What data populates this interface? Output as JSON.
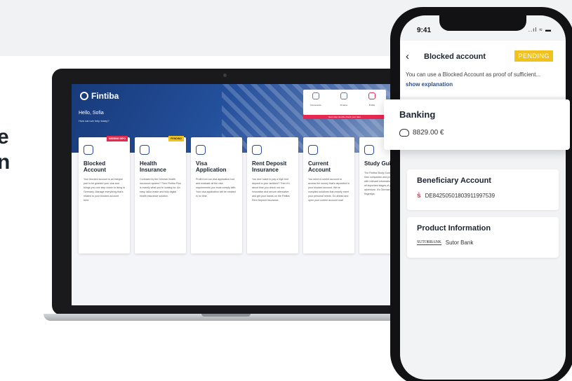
{
  "heading": {
    "line1": "e",
    "line2": "n"
  },
  "laptop": {
    "brand": "Fintiba",
    "greeting": "Hello, Sofia",
    "subgreeting": "How can we help today?",
    "nav": [
      {
        "label": "Documents"
      },
      {
        "label": "Finance"
      },
      {
        "label": "Profile"
      }
    ],
    "alert": "Next step: Enable check your data",
    "cards": [
      {
        "title": "Blocked Account",
        "tag": "MISSING INFO",
        "tagType": "red",
        "desc": "Your blocked account is an integral part to be granted your visa and brings you one step closer to living in Germany. Manage everything that's related to your blocked account here."
      },
      {
        "title": "Health Insurance",
        "tag": "PENDING",
        "tagType": "yellow",
        "desc": "Confused by the German health insurance system? Then Fintiba Plus is exactly what you're looking for. An easy, tailor-made and fully digital health insurance solution."
      },
      {
        "title": "Visa Application",
        "tag": "",
        "tagType": "",
        "desc": "Profit from our visa application tool and evaluate all the visa requirements you must comply with. Your visa application will be created in no time."
      },
      {
        "title": "Rent Deposit Insurance",
        "tag": "",
        "tagType": "",
        "desc": "You don't want to pay a high rent deposit to your landlord? Then it's about time you check out our innovative and secure alternative and get your hands on the Fintiba Rent Deposit Insurance."
      },
      {
        "title": "Current Account",
        "tag": "",
        "tagType": "",
        "desc": "You need a current account to access the money that's deposited in your blocked account. We've compiled solutions that exactly meet your personal needs. Go ahead and open your current account now!"
      },
      {
        "title": "Study Guid",
        "tag": "",
        "tagType": "",
        "desc": "The Fintiba Study Guide is your all time companion and provides you with relevant information throughout all important stages of your German adventure. It's Germany at your fingertips."
      }
    ]
  },
  "phone": {
    "time": "9:41",
    "status_icons": "..ıl ≈ ▬",
    "back_glyph": "‹",
    "title": "Blocked account",
    "badge": "PENDING",
    "description": "You can use a Blocked Account as proof of sufficient...",
    "link": "show explanation",
    "banking": {
      "title": "Banking",
      "amount": "8829.00 €"
    },
    "beneficiary": {
      "title": "Beneficiary Account",
      "iban": "DE84250501803911997539",
      "icon_glyph": "ṡ"
    },
    "product": {
      "title": "Product Information",
      "logo_text": "SUTORBANK",
      "bank": "Sutor Bank"
    }
  },
  "colors": {
    "accent_blue": "#2b4e8f",
    "pending_yellow": "#f1c21b",
    "alert_red": "#e8294f"
  }
}
